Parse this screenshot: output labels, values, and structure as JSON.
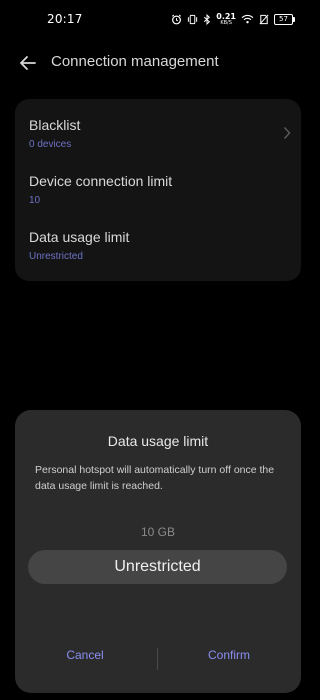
{
  "status_bar": {
    "time": "20:17",
    "net_speed_value": "0.21",
    "net_speed_unit": "KB/S",
    "battery": "57",
    "icons": [
      "alarm-icon",
      "vibrate-icon",
      "bluetooth-icon",
      "wifi-icon",
      "no-sim-icon",
      "battery-icon"
    ]
  },
  "header": {
    "back_icon": "arrow-left-icon",
    "title": "Connection management"
  },
  "settings": [
    {
      "label": "Blacklist",
      "value": "0 devices",
      "has_chevron": true
    },
    {
      "label": "Device connection limit",
      "value": "10",
      "has_chevron": false
    },
    {
      "label": "Data usage limit",
      "value": "Unrestricted",
      "has_chevron": false
    }
  ],
  "dialog": {
    "title": "Data usage limit",
    "message": "Personal hotspot will automatically turn off once the data usage limit is reached.",
    "picker": {
      "previous_option": "10 GB",
      "selected_option": "Unrestricted"
    },
    "cancel_label": "Cancel",
    "confirm_label": "Confirm"
  },
  "colors": {
    "background": "#000000",
    "card": "#141414",
    "dialog": "#2b2b2b",
    "accent": "#8a8ff0",
    "secondary_value": "#6d73c4"
  }
}
